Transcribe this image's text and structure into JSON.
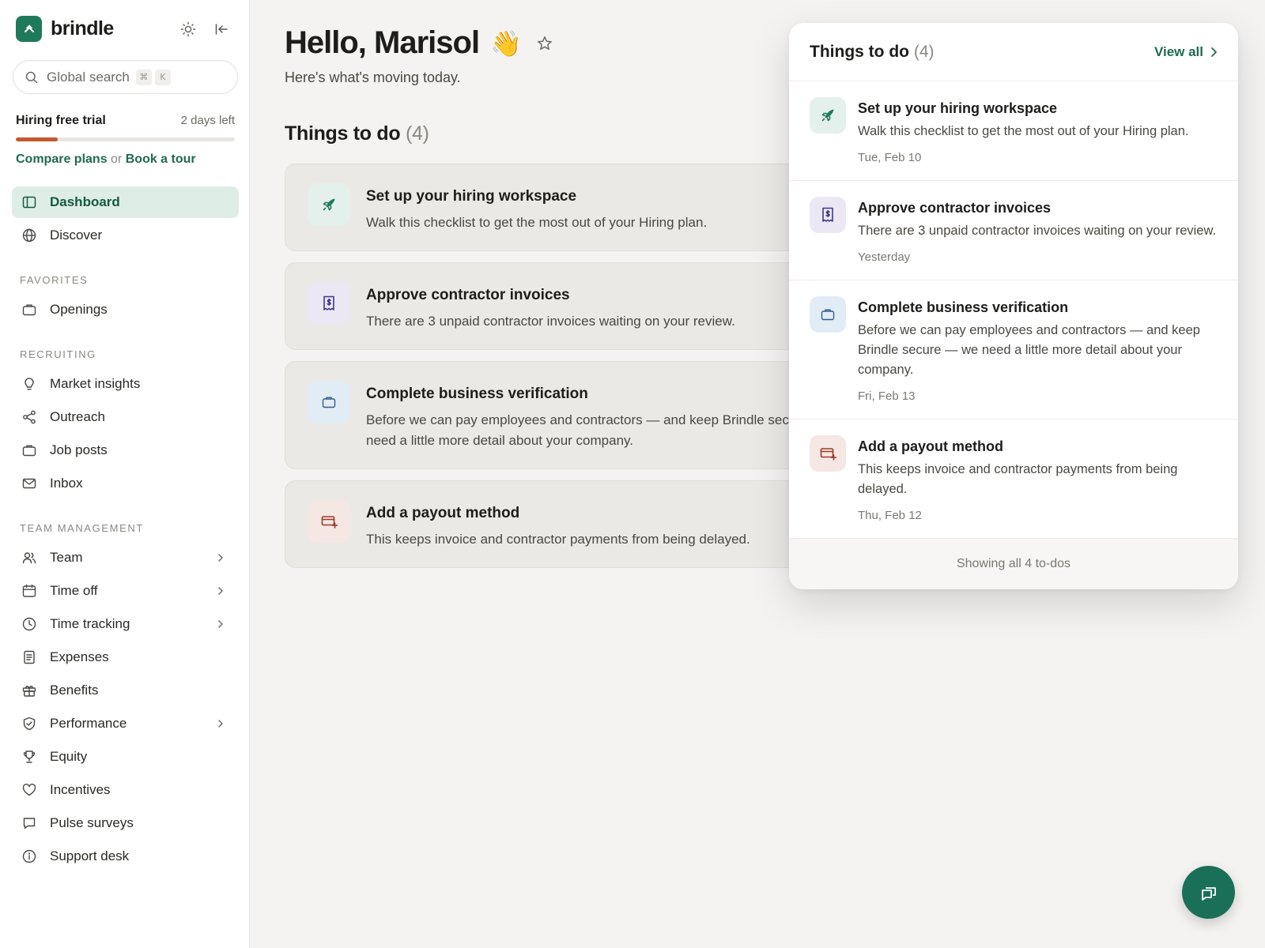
{
  "brand": {
    "name": "brindle"
  },
  "search": {
    "placeholder": "Global search",
    "key_cmd": "⌘",
    "key_k": "K"
  },
  "trial": {
    "title": "Hiring free trial",
    "remaining": "2 days left",
    "progress_fraction": 0.19,
    "compare_link": "Compare plans",
    "or_text": "or",
    "tour_link": "Book a tour"
  },
  "nav": {
    "primary": [
      {
        "label": "Dashboard",
        "icon": "sidebar-panel-icon",
        "active": true
      },
      {
        "label": "Discover",
        "icon": "globe-icon"
      }
    ],
    "favorites_header": "FAVORITES",
    "favorites": [
      {
        "label": "Openings",
        "icon": "briefcase-icon"
      }
    ],
    "recruiting_header": "RECRUITING",
    "recruiting": [
      {
        "label": "Market insights",
        "icon": "lightbulb-icon"
      },
      {
        "label": "Outreach",
        "icon": "share-icon"
      },
      {
        "label": "Job posts",
        "icon": "briefcase-icon"
      },
      {
        "label": "Inbox",
        "icon": "mail-icon"
      }
    ],
    "team_header": "TEAM MANAGEMENT",
    "team": [
      {
        "label": "Team",
        "icon": "users-icon",
        "chevron": true
      },
      {
        "label": "Time off",
        "icon": "calendar-icon",
        "chevron": true
      },
      {
        "label": "Time tracking",
        "icon": "clock-icon",
        "chevron": true
      },
      {
        "label": "Expenses",
        "icon": "receipt-icon"
      },
      {
        "label": "Benefits",
        "icon": "gift-icon"
      },
      {
        "label": "Performance",
        "icon": "shield-icon",
        "chevron": true
      },
      {
        "label": "Equity",
        "icon": "trophy-icon"
      },
      {
        "label": "Incentives",
        "icon": "heart-icon"
      },
      {
        "label": "Pulse surveys",
        "icon": "chat-icon"
      },
      {
        "label": "Support desk",
        "icon": "info-icon"
      }
    ]
  },
  "main": {
    "greeting": "Hello, Marisol",
    "wave": "👋",
    "subtitle": "Here's what's moving today.",
    "todo_title": "Things to do",
    "todo_count": "(4)",
    "todos": [
      {
        "title": "Set up your hiring workspace",
        "desc": "Walk this checklist to get the most out of your Hiring plan.",
        "icon": "rocket-icon",
        "tone": "#e4f0eb"
      },
      {
        "title": "Approve contractor invoices",
        "desc": "There are 3 unpaid contractor invoices waiting on your review.",
        "icon": "invoice-icon",
        "tone": "#ebe8f4"
      },
      {
        "title": "Complete business verification",
        "desc": "Before we can pay employees and contractors — and keep Brindle secure — we need a little more detail about your company.",
        "icon": "briefcase-icon",
        "tone": "#e2ecf5"
      },
      {
        "title": "Add a payout method",
        "desc": "This keeps invoice and contractor payments from being delayed.",
        "icon": "payout-icon",
        "tone": "#f5e7e3"
      }
    ]
  },
  "popover": {
    "title": "Things to do",
    "count": "(4)",
    "view_all": "View all",
    "items": [
      {
        "title": "Set up your hiring workspace",
        "desc": "Walk this checklist to get the most out of your Hiring plan.",
        "date": "Tue, Feb 10"
      },
      {
        "title": "Approve contractor invoices",
        "desc": "There are 3 unpaid contractor invoices waiting on your review.",
        "date": "Yesterday"
      },
      {
        "title": "Complete business verification",
        "desc": "Before we can pay employees and contractors — and keep Brindle secure — we need a little more detail about your company.",
        "date": "Fri, Feb 13"
      },
      {
        "title": "Add a payout method",
        "desc": "This keeps invoice and contractor payments from being delayed.",
        "date": "Thu, Feb 12"
      }
    ],
    "footer": "Showing all 4 to-dos"
  },
  "colors": {
    "accent": "#1f6b52",
    "progress": "#c4582e",
    "fab": "#1a6f57"
  }
}
